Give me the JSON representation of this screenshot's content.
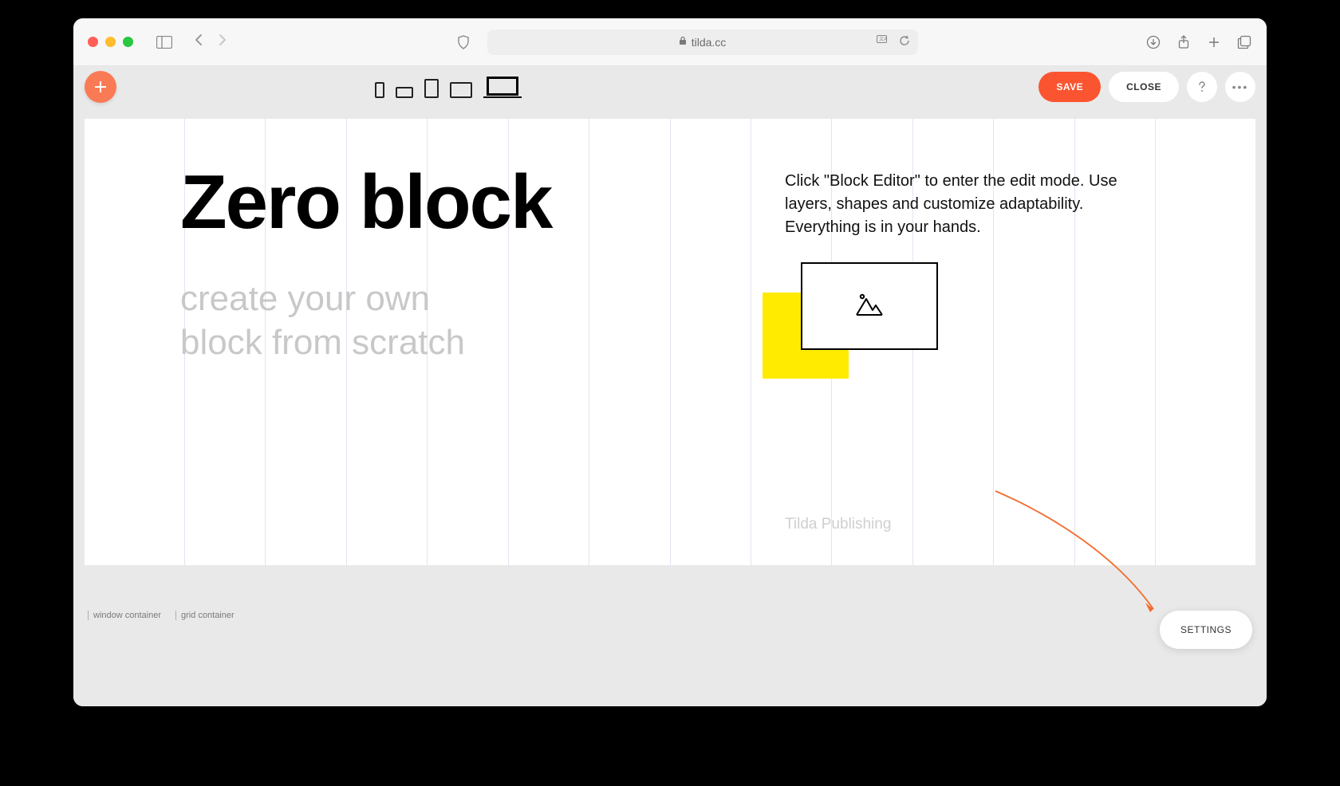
{
  "browser": {
    "url_host": "tilda.cc"
  },
  "toolbar": {
    "save_label": "SAVE",
    "close_label": "CLOSE"
  },
  "canvas": {
    "heading": "Zero block",
    "subheading_line1": "create your own",
    "subheading_line2": "block from scratch",
    "description": "Click \"Block Editor\" to enter the edit mode. Use layers, shapes and customize adaptability. Everything is in your hands.",
    "credit": "Tilda Publishing"
  },
  "legend": {
    "window_container": "window container",
    "grid_container": "grid container"
  },
  "settings": {
    "label": "SETTINGS"
  }
}
